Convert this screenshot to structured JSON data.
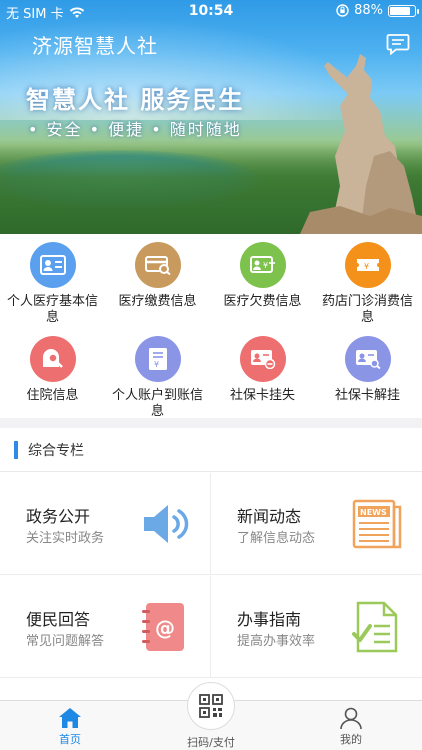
{
  "status_bar": {
    "carrier": "无 SIM 卡",
    "time": "10:54",
    "battery": "88%",
    "battery_level": 0.88
  },
  "header": {
    "title": "济源智慧人社"
  },
  "banner": {
    "slogan": "智慧人社  服务民生",
    "tagline": "• 安全  • 便捷  • 随时随地"
  },
  "services": [
    {
      "label": "个人医疗基本信息",
      "icon": "id-card-icon",
      "color": "#5aa0ee"
    },
    {
      "label": "医疗缴费信息",
      "icon": "payment-card-icon",
      "color": "#c99a5e"
    },
    {
      "label": "医疗欠费信息",
      "icon": "arrears-card-icon",
      "color": "#7cc24d"
    },
    {
      "label": "药店门诊消费信息",
      "icon": "ticket-icon",
      "color": "#f3911a"
    },
    {
      "label": "住院信息",
      "icon": "hospital-search-icon",
      "color": "#ee6f6f"
    },
    {
      "label": "个人账户到账信息",
      "icon": "account-document-icon",
      "color": "#8b95e6"
    },
    {
      "label": "社保卡挂失",
      "icon": "card-lost-icon",
      "color": "#ee6f6f"
    },
    {
      "label": "社保卡解挂",
      "icon": "card-unlock-icon",
      "color": "#8b95e6"
    }
  ],
  "section": {
    "title": "综合专栏",
    "cards": [
      {
        "title": "政务公开",
        "subtitle": "关注实时政务",
        "icon": "speaker-icon"
      },
      {
        "title": "新闻动态",
        "subtitle": "了解信息动态",
        "icon": "news-icon"
      },
      {
        "title": "便民回答",
        "subtitle": "常见问题解答",
        "icon": "address-book-icon"
      },
      {
        "title": "办事指南",
        "subtitle": "提高办事效率",
        "icon": "checklist-document-icon"
      }
    ]
  },
  "tabbar": {
    "home": "首页",
    "scan": "扫码/支付",
    "mine": "我的",
    "active_color": "#1e88e5"
  }
}
